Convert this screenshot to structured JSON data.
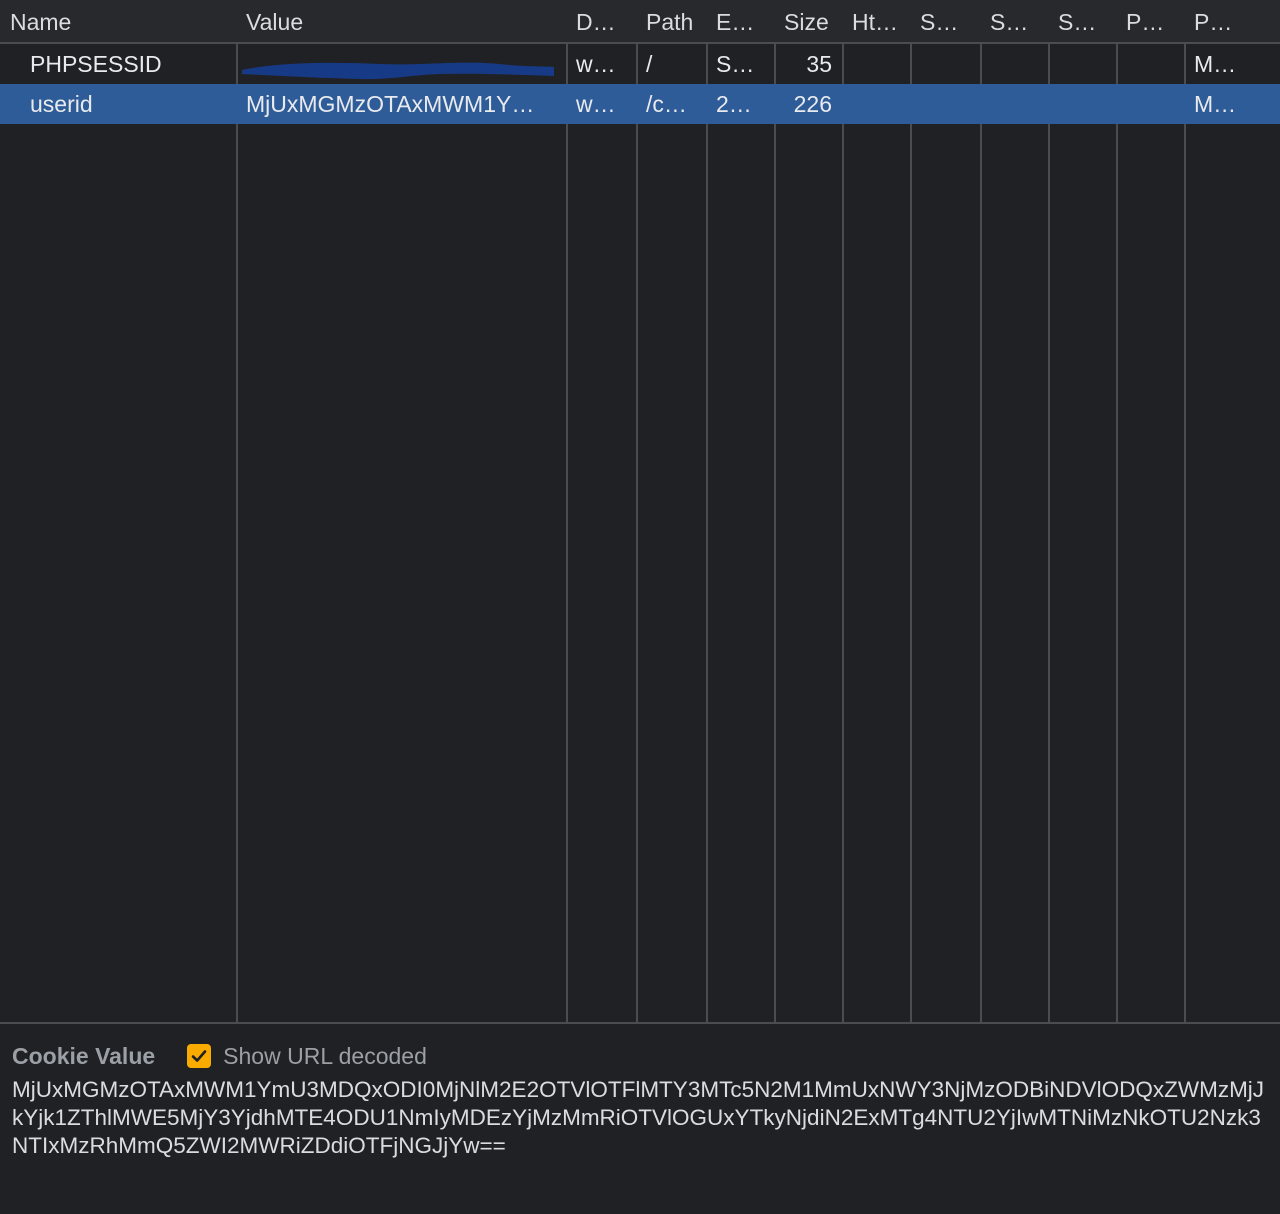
{
  "columns": [
    {
      "label": "Name"
    },
    {
      "label": "Value"
    },
    {
      "label": "D…"
    },
    {
      "label": "Path"
    },
    {
      "label": "E…"
    },
    {
      "label": "Size"
    },
    {
      "label": "Ht…"
    },
    {
      "label": "S…"
    },
    {
      "label": "S…"
    },
    {
      "label": "S…"
    },
    {
      "label": "P…"
    },
    {
      "label": "P…"
    }
  ],
  "rows": [
    {
      "name": "PHPSESSID",
      "value": "",
      "domain": "w…",
      "path": "/",
      "expires": "S…",
      "size": "35",
      "priority": "M…",
      "selected": false
    },
    {
      "name": "userid",
      "value": "MjUxMGMzOTAxMWM1Y…",
      "domain": "w…",
      "path": "/c…",
      "expires": "2…",
      "size": "226",
      "priority": "M…",
      "selected": true
    }
  ],
  "cookie_panel": {
    "title": "Cookie Value",
    "show_url_decoded_label": "Show URL decoded",
    "show_url_decoded_checked": true,
    "value": "MjUxMGMzOTAxMWM1YmU3MDQxODI0MjNlM2E2OTVlOTFlMTY3MTc5N2M1MmUxNWY3NjMzODBiNDVlODQxZWMzMjJkYjk1ZThlMWE5MjY3YjdhMTE4ODU1NmIyMDEzYjMzMmRiOTVlOGUxYTkyNjdiN2ExMTg4NTU2YjIwMTNiMzNkOTU2Nzk3NTIxMzRhMmQ5ZWI2MWRiZDdiOTFjNGJjYw=="
  },
  "colors": {
    "background": "#202124",
    "selection": "#2e5c98",
    "checkbox": "#f9ab00",
    "redaction": "#173a86"
  }
}
